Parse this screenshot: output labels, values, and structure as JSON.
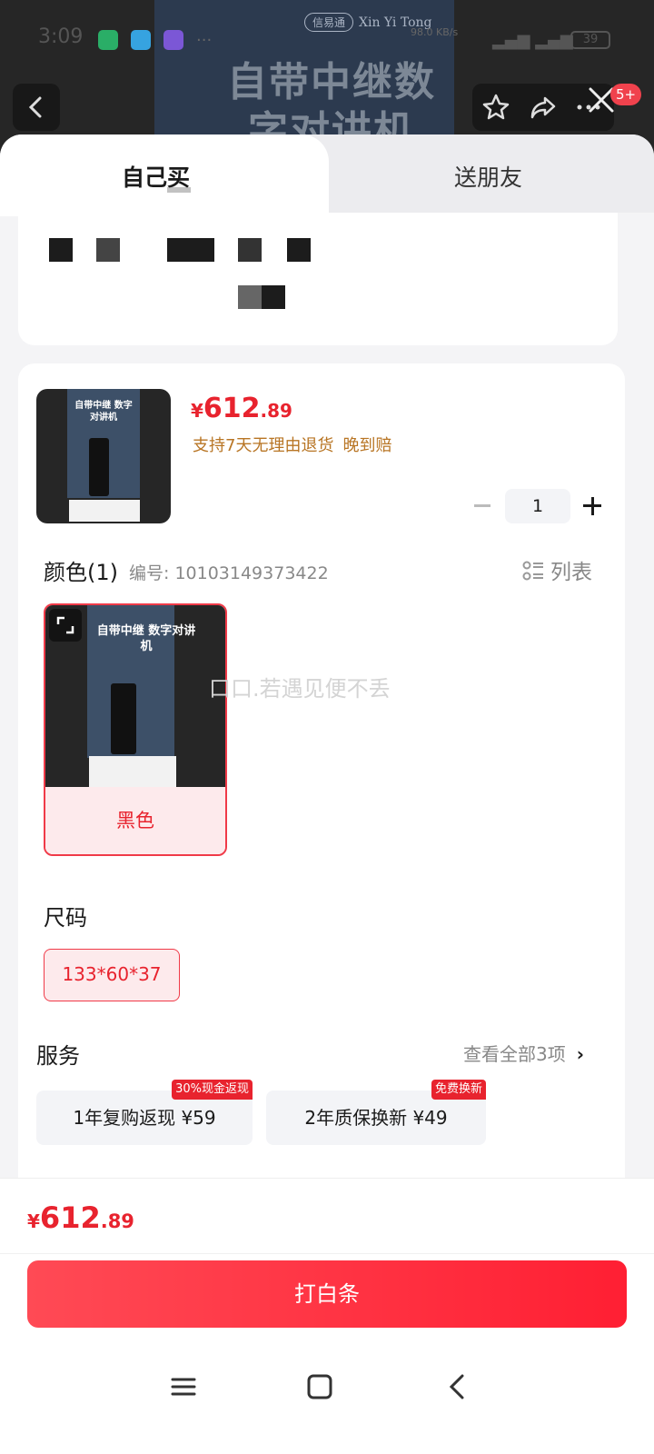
{
  "status_bar": {
    "time": "3:09",
    "more_dots": "···",
    "net_speed": "98.0 KB/s",
    "battery": "39",
    "app_colors": [
      "#2aae67",
      "#36a3e0",
      "#7b57d6"
    ]
  },
  "background": {
    "brand": "Xin Yi Tong",
    "brand_cn": "信易通",
    "headline": "自带中继数字对讲机",
    "badge_count": "5+"
  },
  "tabs": [
    {
      "label": "自己买",
      "active": true
    },
    {
      "label": "送朋友",
      "active": false
    }
  ],
  "product": {
    "thumb_caption": "自带中继 数字对讲机",
    "price": {
      "symbol": "¥",
      "integer": "612",
      "decimal": ".89"
    },
    "tags": [
      "支持7天无理由退货",
      "晚到赔"
    ],
    "quantity": "1"
  },
  "color_section": {
    "title": "颜色(1)",
    "code_label": "编号: 10103149373422",
    "list_toggle": "列表",
    "options": [
      {
        "label": "黑色",
        "selected": true
      }
    ],
    "watermark": "口口.若遇见便不丢"
  },
  "size_section": {
    "title": "尺码",
    "options": [
      {
        "label": "133*60*37",
        "selected": true
      }
    ]
  },
  "service_section": {
    "title": "服务",
    "more": "查看全部3项",
    "items": [
      {
        "label": "1年复购返现  ¥59",
        "badge": "30%现金返现"
      },
      {
        "label": "2年质保换新  ¥49",
        "badge": "免费换新"
      }
    ]
  },
  "bottom_bar": {
    "price": {
      "symbol": "¥",
      "integer": "612",
      "decimal": ".89"
    },
    "button_label": "打白条"
  },
  "colors": {
    "accent": "#e8232e",
    "tag_brown": "#b87524",
    "button_gradient_start": "#ff4a55",
    "button_gradient_end": "#ff1f33"
  }
}
